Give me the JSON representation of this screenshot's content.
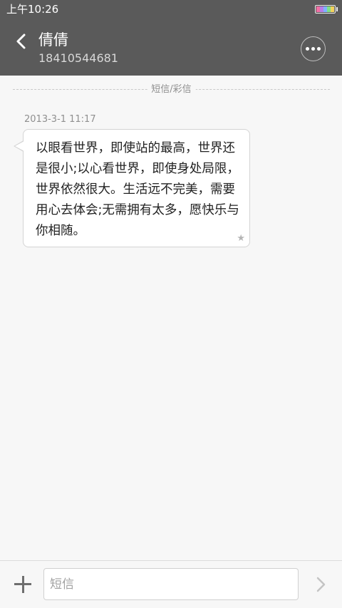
{
  "status_bar": {
    "time": "上午10:26",
    "battery_colors": [
      "#f06fa4",
      "#b77ee8",
      "#7fb2ff",
      "#7fe08a",
      "#f2d25e"
    ]
  },
  "header": {
    "contact_name": "倩倩",
    "contact_number": "18410544681",
    "back_icon": "chevron-left-icon",
    "more_icon": "more-dots-icon"
  },
  "conversation": {
    "divider_label": "短信/彩信",
    "messages": [
      {
        "time": "2013-3-1 11:17",
        "text": "以眼看世界，即使站的最高，世界还是很小;以心看世界，即使身处局限，世界依然很大。生活远不完美，需要用心去体会;无需拥有太多，愿快乐与你相随。",
        "starred_icon": "★"
      }
    ]
  },
  "composer": {
    "add_icon": "plus-icon",
    "placeholder": "短信",
    "value": "",
    "send_icon": "chevron-right-icon"
  },
  "colors": {
    "header_bg": "#5a5a5a",
    "page_bg": "#f7f7f7",
    "bubble_bg": "#ffffff"
  }
}
